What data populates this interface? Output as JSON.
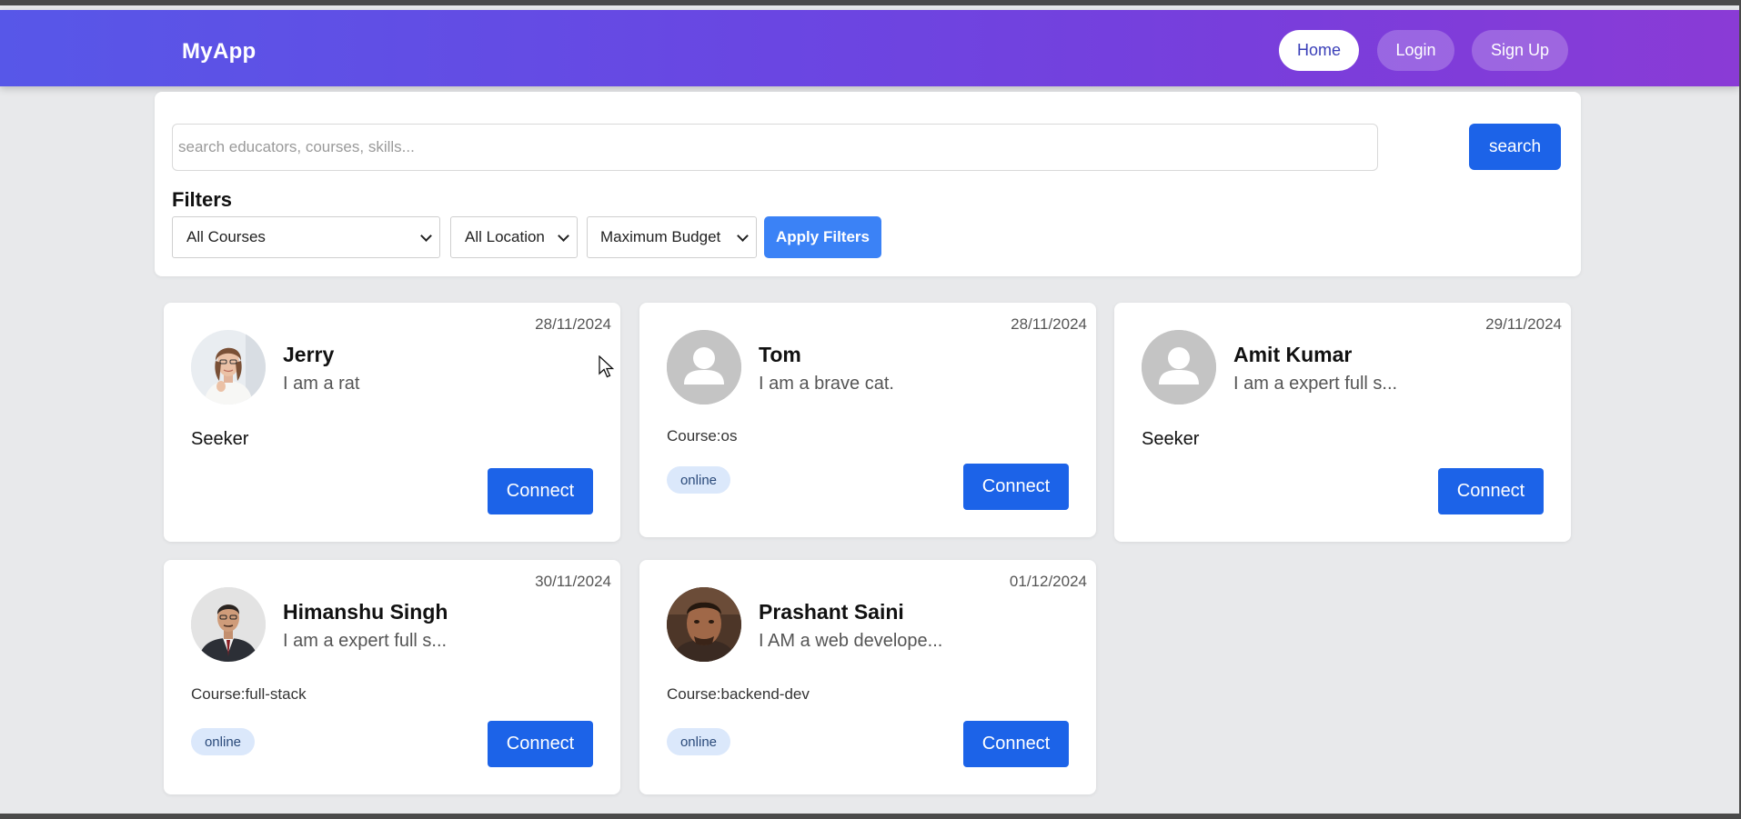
{
  "navbar": {
    "brand": "MyApp",
    "links": [
      "Home",
      "Login",
      "Sign Up"
    ]
  },
  "search": {
    "placeholder": "search educators, courses, skills...",
    "value": "",
    "button_label": "search"
  },
  "filters": {
    "title": "Filters",
    "courses": "All Courses",
    "location": "All Location",
    "budget": "Maximum Budget",
    "apply_label": "Apply Filters"
  },
  "cards": [
    {
      "date": "28/11/2024",
      "name": "Jerry",
      "bio": "I am a rat",
      "role": "Seeker",
      "avatar": "photo-woman"
    },
    {
      "date": "28/11/2024",
      "name": "Tom",
      "bio": "I am a brave cat.",
      "course": "Course:os",
      "mode": "online",
      "avatar": "default-user-icon"
    },
    {
      "date": "29/11/2024",
      "name": "Amit Kumar",
      "bio": "I am a expert full s...",
      "role": "Seeker",
      "avatar": "default-user-icon"
    },
    {
      "date": "30/11/2024",
      "name": "Himanshu Singh",
      "bio": "I am a expert full s...",
      "course": "Course:full-stack",
      "mode": "online",
      "avatar": "photo-man-suit"
    },
    {
      "date": "01/12/2024",
      "name": "Prashant Saini",
      "bio": "I AM a web develope...",
      "course": "Course:backend-dev",
      "mode": "online",
      "avatar": "photo-man"
    }
  ],
  "connect_label": "Connect",
  "colors": {
    "primary": "#1c63e8",
    "apply": "#3b82f6",
    "nav_gradient_start": "#5757e8",
    "nav_gradient_end": "#8a3bd6",
    "badge_bg": "#dbe8fb"
  }
}
